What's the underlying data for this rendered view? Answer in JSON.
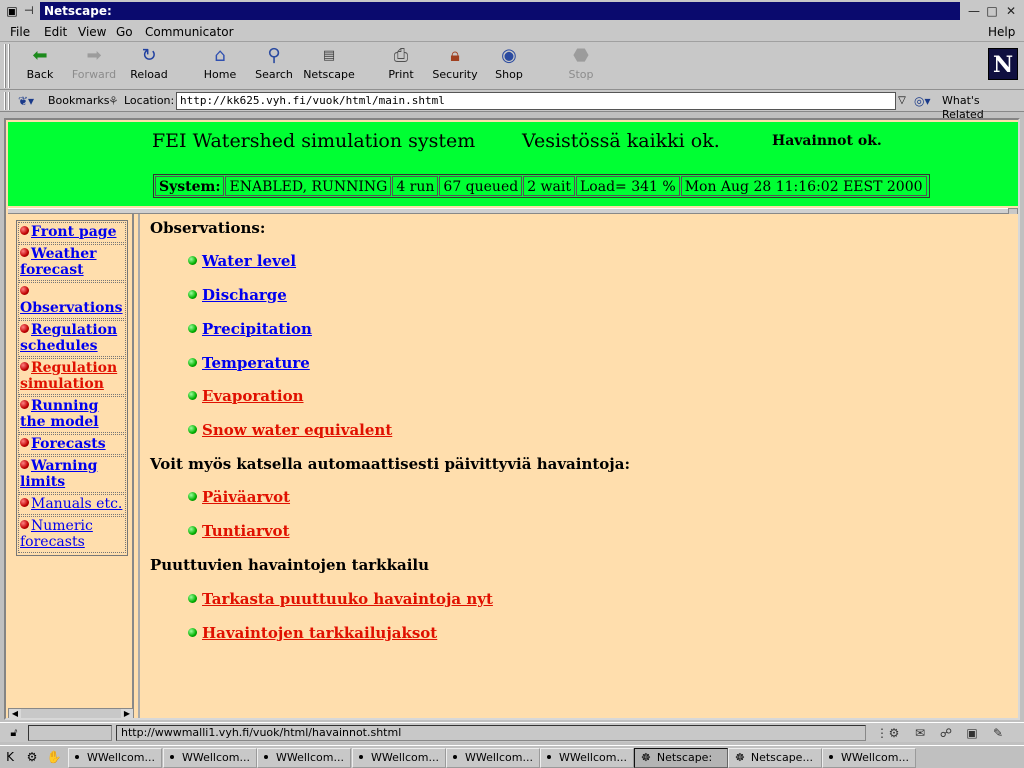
{
  "window": {
    "title": "Netscape:"
  },
  "menubar": {
    "file": "File",
    "edit": "Edit",
    "view": "View",
    "go": "Go",
    "communicator": "Communicator",
    "help": "Help"
  },
  "toolbar": {
    "back": "Back",
    "forward": "Forward",
    "reload": "Reload",
    "home": "Home",
    "search": "Search",
    "netscape": "Netscape",
    "print": "Print",
    "security": "Security",
    "shop": "Shop",
    "stop": "Stop"
  },
  "locationbar": {
    "bookmarks": "Bookmarks",
    "location_label": "Location:",
    "url": "http://kk625.vyh.fi/vuok/html/main.shtml",
    "whats_related": "What's Related"
  },
  "header": {
    "title": "FEI Watershed simulation system",
    "status_ok": "Vesistössä kaikki ok.",
    "observations_ok": "Havainnot ok.",
    "status_cells": [
      "System:",
      "ENABLED, RUNNING",
      "4 run",
      "67 queued",
      "2 wait",
      "Load= 341 %",
      "Mon Aug 28 11:16:02 EEST 2000"
    ]
  },
  "nav": {
    "items": [
      {
        "label": "Front page",
        "color": "blue"
      },
      {
        "label": "Weather forecast",
        "color": "blue"
      },
      {
        "label": "Observations",
        "color": "blue"
      },
      {
        "label": "Regulation schedules",
        "color": "blue"
      },
      {
        "label": "Regulation simulation",
        "color": "red"
      },
      {
        "label": "Running the model",
        "color": "blue"
      },
      {
        "label": "Forecasts",
        "color": "blue"
      },
      {
        "label": "Warning limits",
        "color": "blue"
      },
      {
        "label": "Manuals etc.",
        "color": "blue"
      },
      {
        "label": "Numeric forecasts",
        "color": "blue"
      }
    ]
  },
  "main": {
    "observations_heading": "Observations:",
    "observations": [
      {
        "label": "Water level",
        "color": "blue"
      },
      {
        "label": "Discharge",
        "color": "blue"
      },
      {
        "label": "Precipitation",
        "color": "blue"
      },
      {
        "label": "Temperature",
        "color": "blue"
      },
      {
        "label": "Evaporation",
        "color": "red"
      },
      {
        "label": "Snow water equivalent",
        "color": "red"
      }
    ],
    "auto_heading": "Voit myös katsella automaattisesti päivittyviä havaintoja:",
    "auto_items": [
      {
        "label": "Päiväarvot",
        "color": "red"
      },
      {
        "label": "Tuntiarvot",
        "color": "red"
      }
    ],
    "missing_heading": "Puuttuvien havaintojen tarkkailu",
    "missing_items": [
      {
        "label": "Tarkasta puuttuuko havaintoja nyt",
        "color": "red"
      },
      {
        "label": "Havaintojen tarkkailujaksot",
        "color": "red"
      }
    ]
  },
  "statusbar": {
    "message": "http://wwwmalli1.vyh.fi/vuok/html/havainnot.shtml"
  },
  "taskbar": {
    "tasks": [
      {
        "label": "WWellcom...",
        "active": false
      },
      {
        "label": "WWellcom...",
        "active": false
      },
      {
        "label": "WWellcom...",
        "active": false
      },
      {
        "label": "WWellcom...",
        "active": false
      },
      {
        "label": "WWellcom...",
        "active": false
      },
      {
        "label": "WWellcom...",
        "active": false
      },
      {
        "label": "Netscape:",
        "active": true
      },
      {
        "label": "Netscape...",
        "active": false
      },
      {
        "label": "WWellcom...",
        "active": false
      }
    ]
  },
  "colors": {
    "header_bg": "#00ff33",
    "page_bg": "#ffdead",
    "link_blue": "#0000ee",
    "link_red": "#e01000",
    "titlebar": "#0a0a6e"
  },
  "icons": {
    "back": "back-arrow-icon",
    "forward": "forward-arrow-icon",
    "reload": "reload-icon",
    "home": "home-icon",
    "search": "search-icon",
    "netscape": "netscape-icon",
    "print": "print-icon",
    "security": "lock-icon",
    "shop": "shop-icon",
    "stop": "stop-icon"
  }
}
